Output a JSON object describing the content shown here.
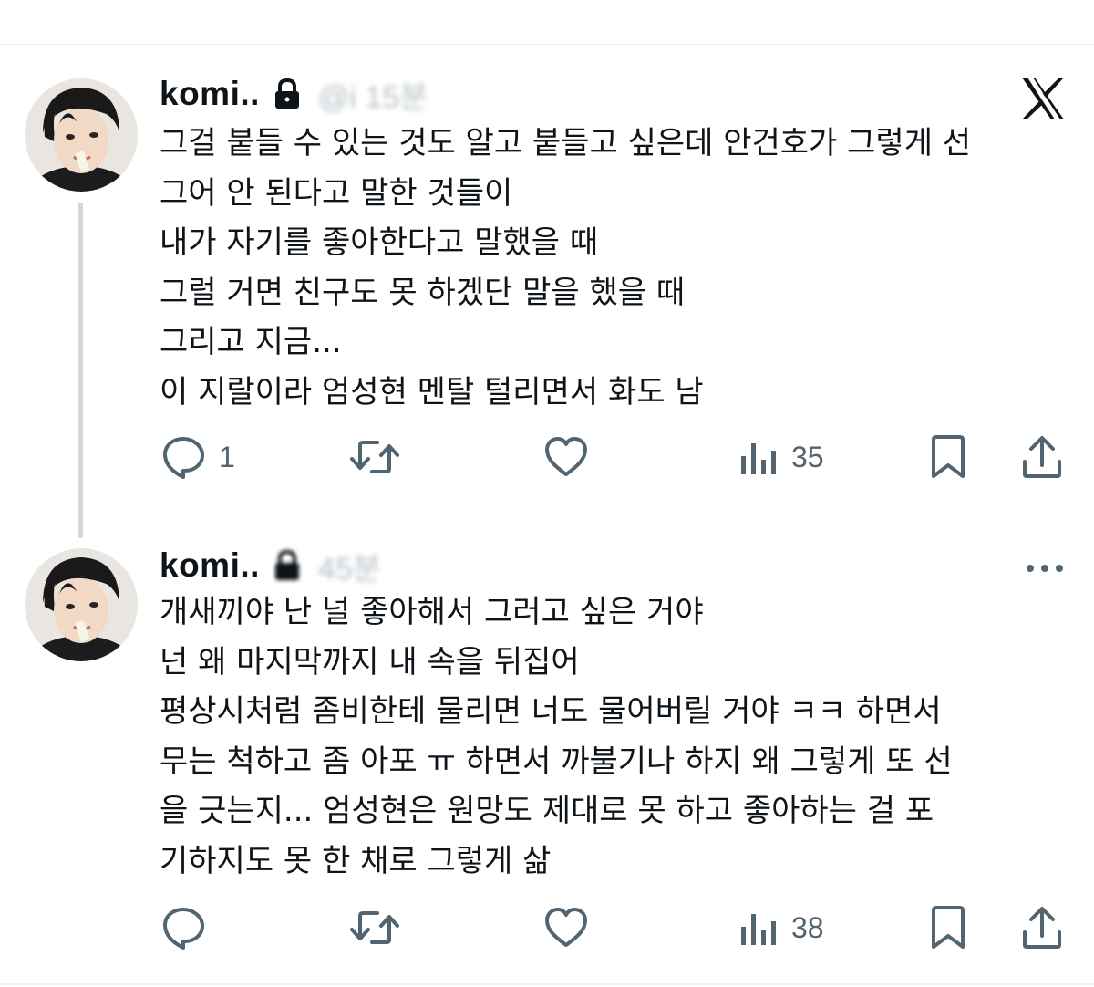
{
  "tweets": [
    {
      "display_name": "komi..",
      "handle": "@i                  15분",
      "avatar": "avatar-photo",
      "lines": [
        "그걸 붙들 수 있는 것도 알고 붙들고 싶은데 안건호가 그렇게 선",
        "그어 안 된다고 말한 것들이",
        "내가 자기를 좋아한다고 말했을 때",
        "그럴 거면 친구도 못 하겠단 말을 했을 때",
        "그리고 지금...",
        "이 지랄이라 엄성현 멘탈 털리면서 화도 남"
      ],
      "reply_count": "1",
      "retweet_count": "",
      "like_count": "",
      "view_count": "35"
    },
    {
      "display_name": "komi..",
      "handle": "                    45분",
      "avatar": "avatar-photo",
      "lines": [
        "개새끼야 난 널 좋아해서 그러고 싶은 거야",
        "넌 왜 마지막까지 내 속을 뒤집어",
        "평상시처럼 좀비한테 물리면 너도 물어버릴 거야 ㅋㅋ 하면서",
        "무는 척하고 좀 아포 ㅠ 하면서 까불기나 하지 왜 그렇게 또 선",
        "을 긋는지... 엄성현은 원망도 제대로 못 하고 좋아하는 걸 포",
        "기하지도 못 한 채로 그렇게 삶"
      ],
      "reply_count": "",
      "retweet_count": "",
      "like_count": "",
      "view_count": "38"
    }
  ],
  "icons": {
    "logo": "x-logo-icon",
    "lock": "lock-icon",
    "more": "more-icon",
    "reply": "reply-icon",
    "retweet": "retweet-icon",
    "like": "heart-icon",
    "views": "views-icon",
    "bookmark": "bookmark-icon",
    "share": "share-icon"
  },
  "colors": {
    "text": "#0f1419",
    "secondary": "#536471",
    "thread_line": "#cfd9de",
    "divider": "#eff3f4"
  }
}
